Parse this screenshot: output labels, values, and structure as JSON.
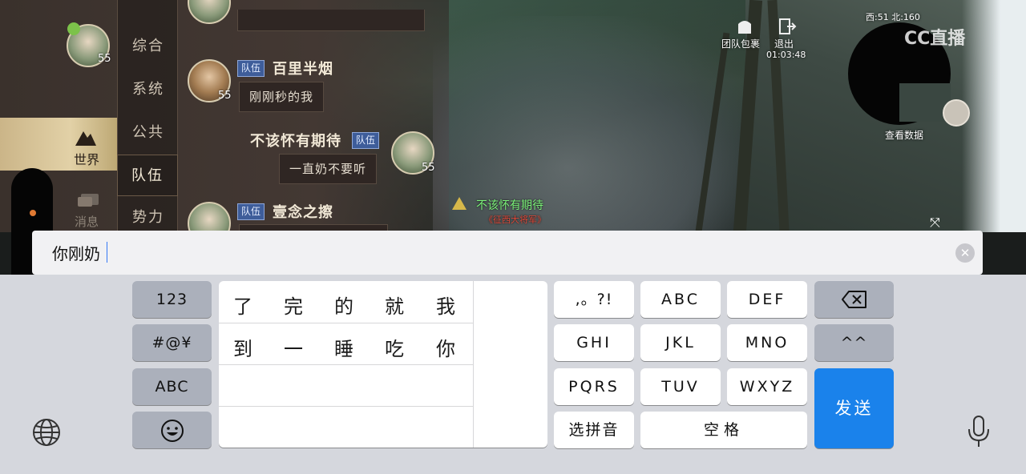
{
  "chat": {
    "self_level": "55",
    "nav": {
      "items": [
        "综合",
        "系统",
        "公共",
        "队伍",
        "势力"
      ],
      "active": "队伍"
    },
    "side_tabs": {
      "world": "世界",
      "messages": "消息"
    },
    "messages": [
      {
        "sender": "百里半烟",
        "tag": "队伍",
        "level": "55",
        "text": "刚刚秒的我"
      },
      {
        "sender": "不该怀有期待",
        "tag": "队伍",
        "level": "55",
        "text": "一直奶不要听"
      },
      {
        "sender": "壹念之擦",
        "tag": "队伍",
        "level": ""
      }
    ]
  },
  "hud": {
    "team_bag": "团队包裹",
    "exit": "退出",
    "timer": "01:03:48",
    "coords": "西:51 北:160",
    "view_data": "查看数据",
    "watermark": "CC直播",
    "player_name": "不该怀有期待",
    "player_title": "《征西大将军》"
  },
  "input": {
    "value": "你刚奶",
    "clear_icon": "clear-circle-icon"
  },
  "keyboard": {
    "left_keys": [
      "123",
      "#@¥",
      "ABC"
    ],
    "emoji_icon": "emoji-icon",
    "candidates_row1": [
      "了",
      "完",
      "的",
      "就",
      "我"
    ],
    "candidates_row2": [
      "到",
      "一",
      "睡",
      "吃",
      "你"
    ],
    "letter_keys": [
      ",。?!",
      "ABC",
      "DEF",
      "GHI",
      "JKL",
      "MNO",
      "PQRS",
      "TUV",
      "WXYZ"
    ],
    "select_pinyin": "选拼音",
    "space": "空格",
    "backspace_icon": "backspace-icon",
    "caret_key": "^^",
    "send": "发送",
    "globe_icon": "globe-icon",
    "mic_icon": "microphone-icon"
  },
  "colors": {
    "send_key": "#1a82eb",
    "caret": "#3478f6",
    "team_tag": "#3e5d9a"
  }
}
